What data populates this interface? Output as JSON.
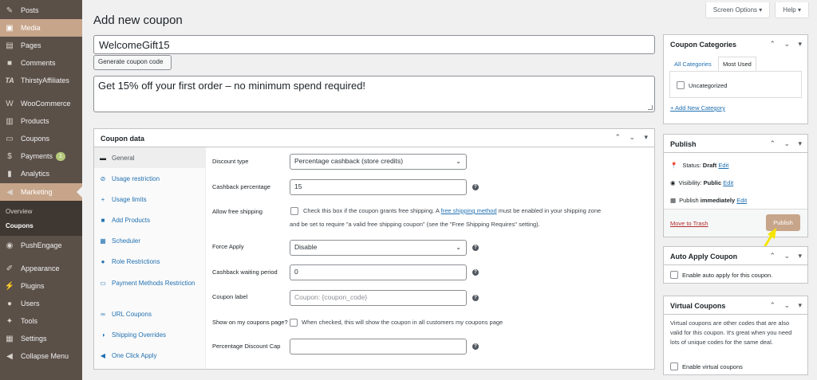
{
  "sidebar": {
    "items": [
      {
        "label": "Posts",
        "icon": "pushpin-icon"
      },
      {
        "label": "Media",
        "icon": "media-icon"
      },
      {
        "label": "Pages",
        "icon": "pages-icon"
      },
      {
        "label": "Comments",
        "icon": "comments-icon"
      },
      {
        "label": "ThirstyAffiliates",
        "icon": "ta-icon"
      },
      {
        "label": "WooCommerce",
        "icon": "woo-icon"
      },
      {
        "label": "Products",
        "icon": "products-icon"
      },
      {
        "label": "Coupons",
        "icon": "coupons-icon"
      },
      {
        "label": "Payments",
        "icon": "payments-icon",
        "badge": "1"
      },
      {
        "label": "Analytics",
        "icon": "analytics-icon"
      },
      {
        "label": "Marketing",
        "icon": "megaphone-icon"
      },
      {
        "label": "PushEngage",
        "icon": "pushengage-icon"
      },
      {
        "label": "Appearance",
        "icon": "brush-icon"
      },
      {
        "label": "Plugins",
        "icon": "plugin-icon"
      },
      {
        "label": "Users",
        "icon": "users-icon"
      },
      {
        "label": "Tools",
        "icon": "wrench-icon"
      },
      {
        "label": "Settings",
        "icon": "settings-icon"
      },
      {
        "label": "Collapse Menu",
        "icon": "collapse-icon"
      }
    ],
    "submenu": {
      "overview": "Overview",
      "coupons": "Coupons"
    }
  },
  "top": {
    "screen_options": "Screen Options ▾",
    "help": "Help ▾"
  },
  "page_title": "Add new coupon",
  "coupon_code": "WelcomeGift15",
  "generate_label": "Generate coupon code",
  "description": "Get 15% off your first order – no minimum spend required!",
  "coupon_data": {
    "title": "Coupon data",
    "tabs": [
      "General",
      "Usage restriction",
      "Usage limits",
      "Add Products",
      "Scheduler",
      "Role Restrictions",
      "Payment Methods Restriction",
      "URL Coupons",
      "Shipping Overrides",
      "One Click Apply"
    ],
    "fields": {
      "discount_type_label": "Discount type",
      "discount_type_value": "Percentage cashback (store credits)",
      "cashback_label": "Cashback percentage",
      "cashback_value": "15",
      "free_ship_label": "Allow free shipping",
      "free_ship_text1": "Check this box if the coupon grants free shipping. A ",
      "free_ship_link": "free shipping method",
      "free_ship_text2": " must be enabled in your shipping zone",
      "free_ship_text3": "and be set to require \"a valid free shipping coupon\" (see the \"Free Shipping Requires\" setting).",
      "force_apply_label": "Force Apply",
      "force_apply_value": "Disable",
      "waiting_label": "Cashback waiting period",
      "waiting_value": "0",
      "coupon_label_label": "Coupon label",
      "coupon_label_placeholder": "Coupon: {coupon_code}",
      "show_label": "Show on my coupons page?",
      "show_text": "When checked, this will show the coupon in all customers my coupons page",
      "cap_label": "Percentage Discount Cap",
      "cap_value": ""
    }
  },
  "categories": {
    "title": "Coupon Categories",
    "tab_all": "All Categories",
    "tab_most": "Most Used",
    "item": "Uncategorized",
    "add": "+ Add New Category"
  },
  "publish": {
    "title": "Publish",
    "status_label": "Status: ",
    "status_value": "Draft",
    "visibility_label": "Visibility: ",
    "visibility_value": "Public",
    "publish_label": "Publish ",
    "publish_value": "immediately",
    "edit": "Edit",
    "trash": "Move to Trash",
    "button": "Publish"
  },
  "auto_apply": {
    "title": "Auto Apply Coupon",
    "text": "Enable auto apply for this coupon."
  },
  "virtual": {
    "title": "Virtual Coupons",
    "desc": "Virtual coupons are other codes that are also valid for this coupon. It's great when you need lots of unique codes for the same deal.",
    "checkbox": "Enable virtual coupons"
  },
  "accent_color": "#c7a58a",
  "arrow_color": "#f5e400"
}
